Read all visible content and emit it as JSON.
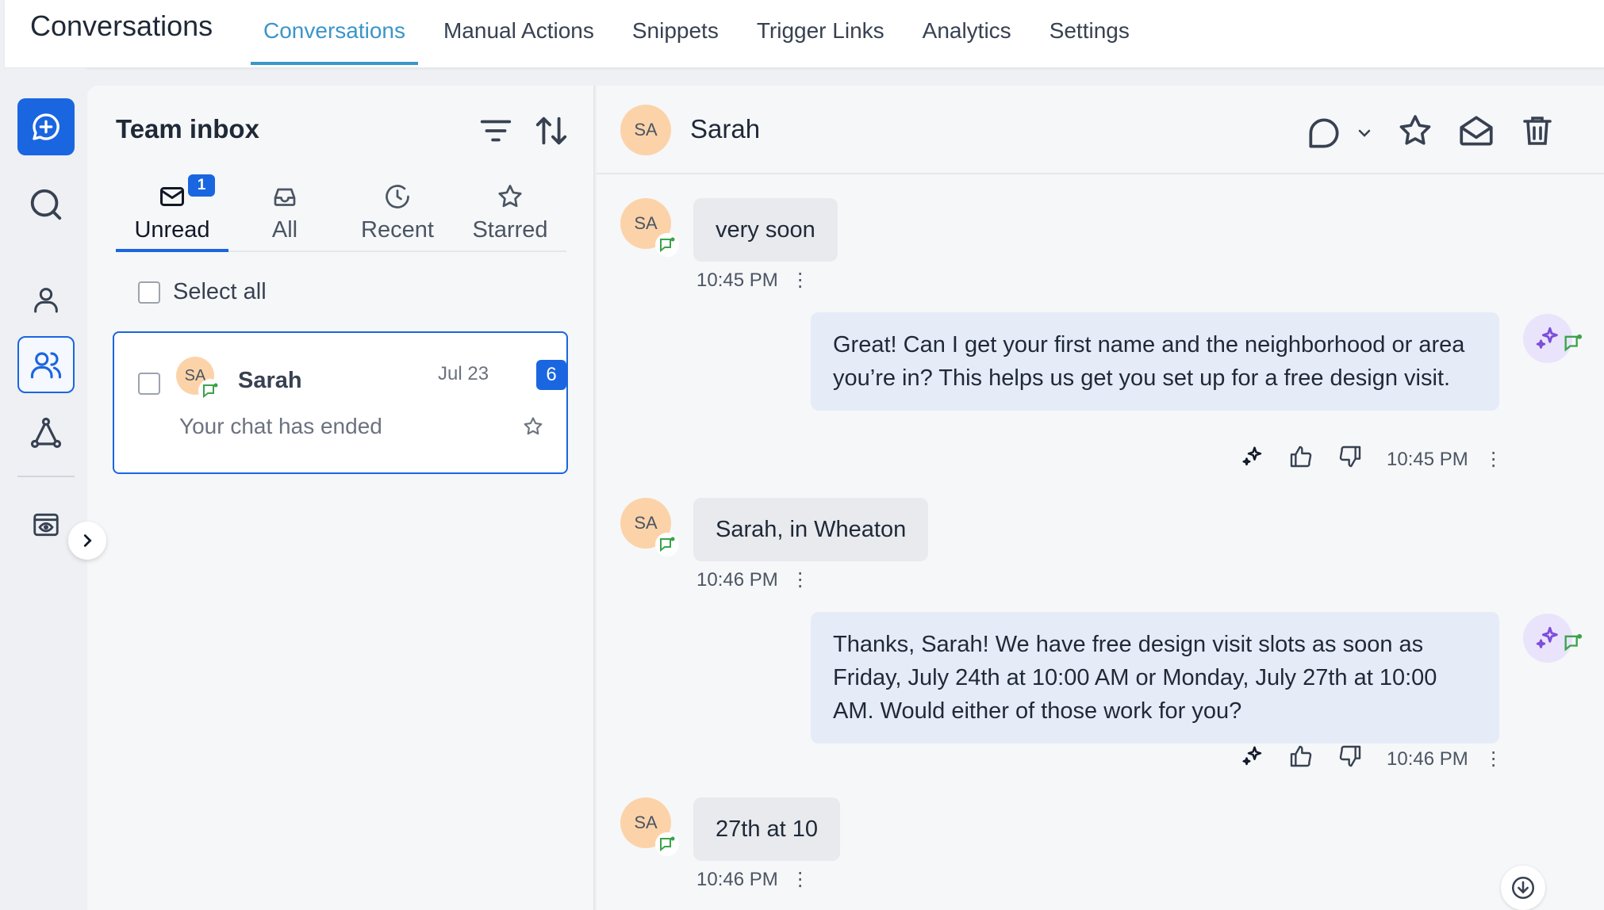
{
  "app_title": "Conversations",
  "top_tabs": [
    "Conversations",
    "Manual Actions",
    "Snippets",
    "Trigger Links",
    "Analytics",
    "Settings"
  ],
  "colors": {
    "accent": "#1a66e0",
    "tab_active": "#3b95c9",
    "avatar": "#fcd3a9",
    "channel_green": "#3aa34a",
    "ai_purple": "#7c4ddc"
  },
  "inbox": {
    "title": "Team inbox",
    "tabs": [
      {
        "label": "Unread",
        "icon": "mail-icon",
        "badge": "1"
      },
      {
        "label": "All",
        "icon": "inbox-icon"
      },
      {
        "label": "Recent",
        "icon": "clock-icon"
      },
      {
        "label": "Starred",
        "icon": "star-icon"
      }
    ],
    "select_all": "Select all",
    "conversations": [
      {
        "initials": "SA",
        "name": "Sarah",
        "date": "Jul 23",
        "count": "6",
        "preview": "Your chat has ended"
      }
    ]
  },
  "chat": {
    "contact_initials": "SA",
    "contact_name": "Sarah",
    "messages": [
      {
        "dir": "in",
        "text": "very soon",
        "time": "10:45 PM"
      },
      {
        "dir": "out",
        "text": "Great! Can I get your first name and the neighborhood or area you’re in? This helps us get you set up for a free design visit.",
        "time": "10:45 PM"
      },
      {
        "dir": "in",
        "text": "Sarah, in Wheaton",
        "time": "10:46 PM"
      },
      {
        "dir": "out",
        "text": "Thanks, Sarah! We have free design visit slots as soon as Friday, July 24th at 10:00 AM or Monday, July 27th at 10:00 AM. Would either of those work for you?",
        "time": "10:46 PM"
      },
      {
        "dir": "in",
        "text": "27th at 10",
        "time": "10:46 PM"
      }
    ]
  }
}
